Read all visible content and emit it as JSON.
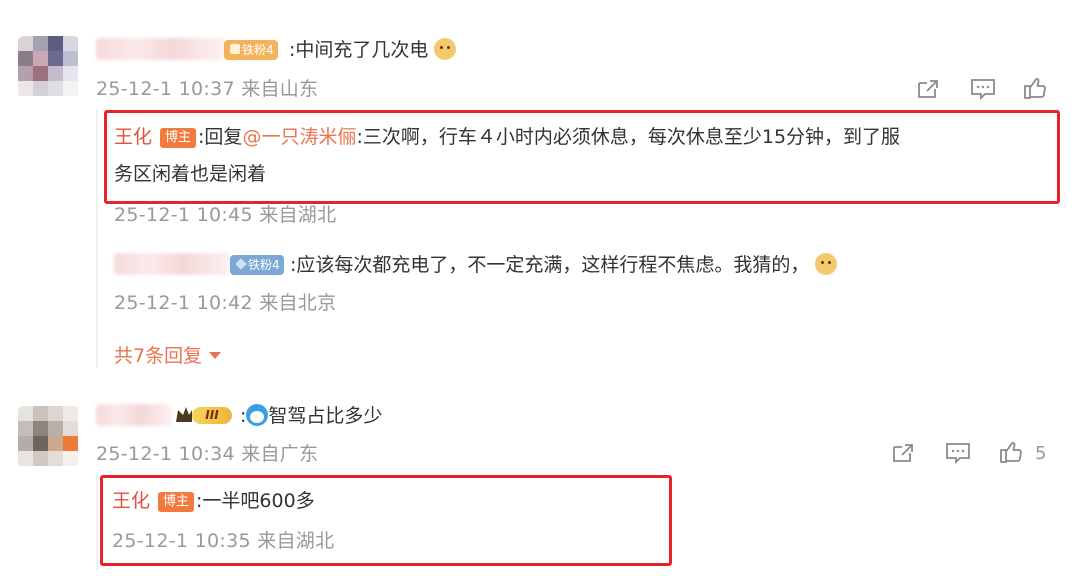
{
  "comments": [
    {
      "fan_badge": "铁粉4",
      "text": ":中间充了几次电",
      "emoji": "doge-emoji",
      "meta": "25-12-1 10:37 来自山东",
      "actions": {
        "share": "share-icon",
        "reply": "comment-icon",
        "like": "like-icon"
      },
      "replies": [
        {
          "author": "王化",
          "badge": "博主",
          "prefix": ":回复",
          "mention": "@一只涛米俪",
          "text_line1": ":三次啊，行车４小时内必须休息，每次休息至少15分钟，到了服",
          "text_line2": "务区闲着也是闲着",
          "meta": "25-12-1 10:45 来自湖北"
        },
        {
          "fan_badge": "铁粉4",
          "text": ":应该每次都充电了，不一定充满，这样行程不焦虑。我猜的，",
          "emoji": "doge-emoji",
          "meta": "25-12-1 10:42 来自北京"
        }
      ],
      "more_replies": "共7条回复"
    },
    {
      "level_badge": "III",
      "text": "智驾占比多少",
      "emoji": "doraemon-emoji",
      "meta": "25-12-1 10:34 来自广东",
      "like_count": "5",
      "replies": [
        {
          "author": "王化",
          "badge": "博主",
          "text": ":一半吧600多",
          "meta": "25-12-1 10:35 来自湖北"
        }
      ]
    }
  ],
  "colors": {
    "accent": "#eb7350",
    "highlight_box": "#e8232a",
    "meta": "#999999",
    "host_badge": "#f27a3e"
  }
}
